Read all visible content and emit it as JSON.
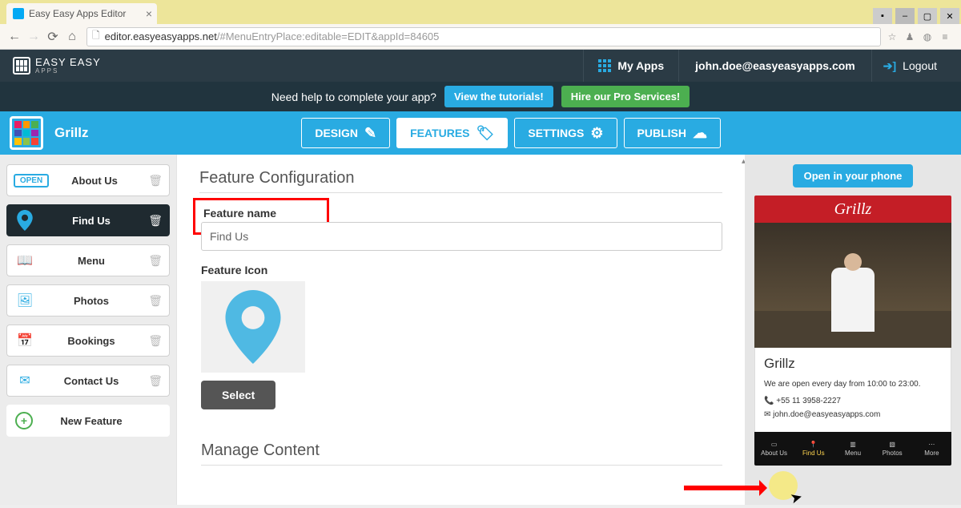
{
  "browser": {
    "tab_title": "Easy Easy Apps Editor",
    "url_host": "editor.easyeasyapps.net",
    "url_path": "/#MenuEntryPlace:editable=EDIT&appId=84605"
  },
  "topbar": {
    "logo_line1": "EASY EASY",
    "logo_line2": "APPS",
    "myapps": "My Apps",
    "user_email": "john.doe@easyeasyapps.com",
    "logout": "Logout"
  },
  "helpbar": {
    "prompt": "Need help to complete your app?",
    "tutorials_btn": "View the tutorials!",
    "pro_btn": "Hire our Pro Services!"
  },
  "subheader": {
    "app_name": "Grillz",
    "tabs": {
      "design": "DESIGN",
      "features": "FEATURES",
      "settings": "SETTINGS",
      "publish": "PUBLISH"
    },
    "active_tab": "features"
  },
  "sidebar": {
    "items": [
      {
        "label": "About Us",
        "icon": "open"
      },
      {
        "label": "Find Us",
        "icon": "pin",
        "active": true
      },
      {
        "label": "Menu",
        "icon": "book"
      },
      {
        "label": "Photos",
        "icon": "image"
      },
      {
        "label": "Bookings",
        "icon": "calendar"
      },
      {
        "label": "Contact Us",
        "icon": "mail"
      }
    ],
    "new_feature": "New Feature"
  },
  "content": {
    "section_title": "Feature Configuration",
    "feature_name_label": "Feature name",
    "feature_name_value": "Find Us",
    "feature_icon_label": "Feature Icon",
    "select_btn": "Select",
    "manage_title": "Manage Content"
  },
  "preview": {
    "open_btn": "Open in your phone",
    "brand": "Grillz",
    "app_title": "Grillz",
    "hours_line": "We are open every day from 10:00 to 23:00.",
    "phone_number": "+55 11 3958-2227",
    "email": "john.doe@easyeasyapps.com",
    "tabs": [
      "About Us",
      "Find Us",
      "Menu",
      "Photos",
      "More"
    ],
    "selected_tab_index": 1
  }
}
